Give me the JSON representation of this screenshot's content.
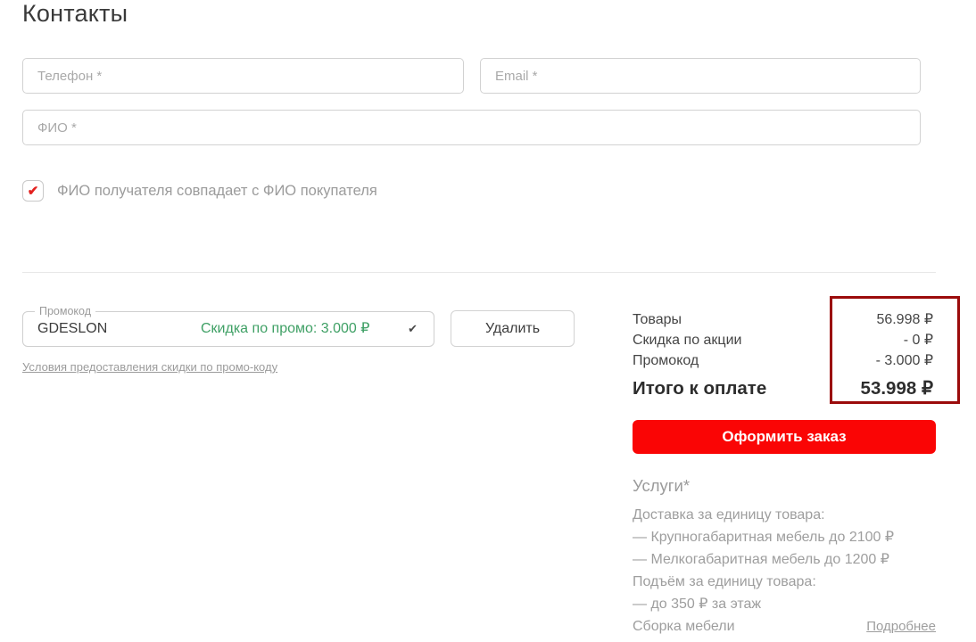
{
  "page": {
    "title": "Контакты"
  },
  "form": {
    "phone": {
      "placeholder": "Телефон *",
      "value": ""
    },
    "email": {
      "placeholder": "Email *",
      "value": ""
    },
    "full_name": {
      "placeholder": "ФИО *",
      "value": ""
    },
    "recipient_checkbox": {
      "checked": true,
      "check_glyph": "✔",
      "label": "ФИО получателя совпадает с ФИО покупателя"
    }
  },
  "promo": {
    "label": "Промокод",
    "code": "GDESLON",
    "discount_text": "Скидка по промо: 3.000 ₽",
    "check_icon": "✔",
    "delete_button": "Удалить",
    "terms_link": "Условия предоставления скидки по промо-коду"
  },
  "summary": {
    "rows": [
      {
        "label": "Товары",
        "value": "56.998 ₽"
      },
      {
        "label": "Скидка по акции",
        "value": "- 0 ₽"
      },
      {
        "label": "Промокод",
        "value": "- 3.000 ₽"
      }
    ],
    "total": {
      "label": "Итого к оплате",
      "value": "53.998 ₽"
    }
  },
  "checkout_button": "Оформить заказ",
  "services": {
    "title": "Услуги*",
    "lines": [
      "Доставка за единицу товара:",
      "— Крупногабаритная мебель до 2100 ₽",
      "— Мелкогабаритная мебель до 1200 ₽",
      "Подъём за единицу товара:",
      "— до 350 ₽ за этаж",
      "Сборка мебели"
    ],
    "more_link": "Подробнее"
  },
  "colors": {
    "accent_red": "#fa0505",
    "promo_green": "#3fa065",
    "checkmark_red": "#e3211f",
    "annotation_red": "#9b0b0b"
  }
}
